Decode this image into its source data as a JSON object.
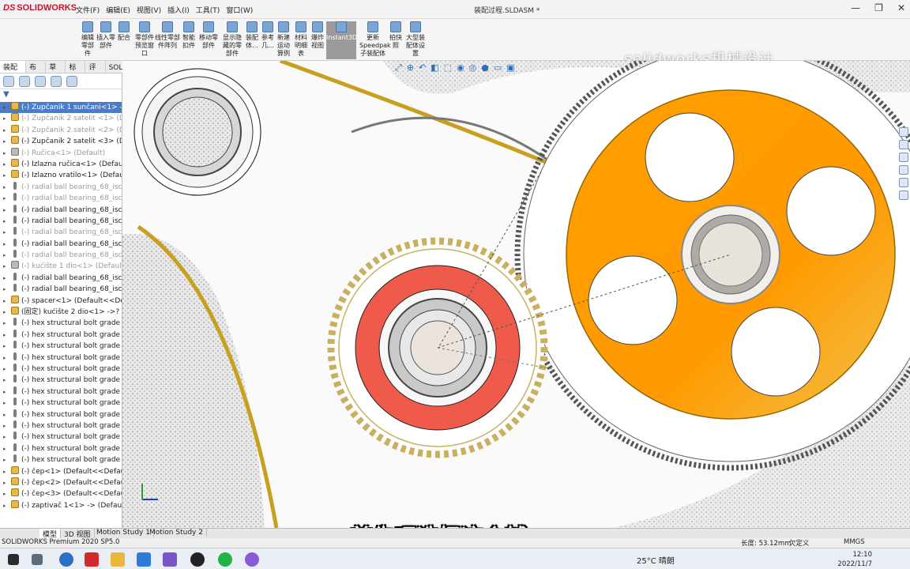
{
  "app": {
    "logo_text": "SOLIDWORKS",
    "document_title": "装配过程.SLDASM *",
    "menus": [
      "文件(F)",
      "编辑(E)",
      "视图(V)",
      "插入(I)",
      "工具(T)",
      "窗口(W)"
    ]
  },
  "ribbon": {
    "buttons": [
      "编辑零部件",
      "插入零部件",
      "配合",
      "零部件预览窗口",
      "线性零部件阵列",
      "智能扣件",
      "移动零部件",
      "显示隐藏的零部件",
      "装配体...",
      "参考几...",
      "新建运动算例",
      "材料明细表",
      "爆炸视图",
      "Instant3D",
      "更新Speedpak子装配体",
      "拍快照",
      "大型装配体设置"
    ],
    "active_button": "Instant3D"
  },
  "watermark": "solidworks机械设计",
  "command_tabs": [
    "装配体",
    "布局",
    "草图",
    "标注",
    "评估",
    "SOLIDWORKS 插件"
  ],
  "feature_tree": {
    "items": [
      {
        "label": "(-) Zupčanik 1 sunčani<1> -",
        "type": "asm",
        "state": "selected"
      },
      {
        "label": "(-) Zupčanik 2 satelit <1> (D",
        "type": "asm",
        "state": "suppressed"
      },
      {
        "label": "(-) Zupčanik 2 satelit <2> (D",
        "type": "asm",
        "state": "suppressed"
      },
      {
        "label": "(-) Zupčanik 2 satelit <3> (D",
        "type": "asm",
        "state": "normal"
      },
      {
        "label": "(-) Ručica<1> (Default)",
        "type": "part",
        "state": "suppressed"
      },
      {
        "label": "(-) Izlazna ručica<1> (Defau",
        "type": "asm",
        "state": "normal"
      },
      {
        "label": "(-) Izlazno vratilo<1> (Defau",
        "type": "asm",
        "state": "normal"
      },
      {
        "label": "(-) radial ball bearing_68_isc",
        "type": "bolt",
        "state": "suppressed"
      },
      {
        "label": "(-) radial ball bearing_68_isc",
        "type": "bolt",
        "state": "suppressed"
      },
      {
        "label": "(-) radial ball bearing_68_isc",
        "type": "bolt",
        "state": "normal"
      },
      {
        "label": "(-) radial ball bearing_68_isc",
        "type": "bolt",
        "state": "normal"
      },
      {
        "label": "(-) radial ball bearing_68_isc",
        "type": "bolt",
        "state": "suppressed"
      },
      {
        "label": "(-) radial ball bearing_68_isc",
        "type": "bolt",
        "state": "normal"
      },
      {
        "label": "(-) radial ball bearing_68_isc",
        "type": "bolt",
        "state": "suppressed"
      },
      {
        "label": "(-) kućište 1 dio<1> (Default",
        "type": "part",
        "state": "suppressed"
      },
      {
        "label": "(-) radial ball bearing_68_isc",
        "type": "bolt",
        "state": "normal"
      },
      {
        "label": "(-) radial ball bearing_68_isc",
        "type": "bolt",
        "state": "normal"
      },
      {
        "label": "(-) spacer<1> (Default<<De",
        "type": "asm",
        "state": "normal"
      },
      {
        "label": "(固定) kućište 2 dio<1> ->? (",
        "type": "asm",
        "state": "normal"
      },
      {
        "label": "(-) hex structural bolt grade",
        "type": "bolt",
        "state": "normal"
      },
      {
        "label": "(-) hex structural bolt grade",
        "type": "bolt",
        "state": "normal"
      },
      {
        "label": "(-) hex structural bolt grade",
        "type": "bolt",
        "state": "normal"
      },
      {
        "label": "(-) hex structural bolt grade",
        "type": "bolt",
        "state": "normal"
      },
      {
        "label": "(-) hex structural bolt grade",
        "type": "bolt",
        "state": "normal"
      },
      {
        "label": "(-) hex structural bolt grade",
        "type": "bolt",
        "state": "normal"
      },
      {
        "label": "(-) hex structural bolt grade",
        "type": "bolt",
        "state": "normal"
      },
      {
        "label": "(-) hex structural bolt grade",
        "type": "bolt",
        "state": "normal"
      },
      {
        "label": "(-) hex structural bolt grade",
        "type": "bolt",
        "state": "normal"
      },
      {
        "label": "(-) hex structural bolt grade",
        "type": "bolt",
        "state": "normal"
      },
      {
        "label": "(-) hex structural bolt grade",
        "type": "bolt",
        "state": "normal"
      },
      {
        "label": "(-) hex structural bolt grade",
        "type": "bolt",
        "state": "normal"
      },
      {
        "label": "(-) hex structural bolt grade",
        "type": "bolt",
        "state": "normal"
      },
      {
        "label": "(-) čep<1> (Default<<Defau",
        "type": "asm",
        "state": "normal"
      },
      {
        "label": "(-) čep<2> (Default<<Defau",
        "type": "asm",
        "state": "normal"
      },
      {
        "label": "(-) čep<3> (Default<<Defau",
        "type": "asm",
        "state": "normal"
      },
      {
        "label": "(-) zaptivač 1<1> -> (Defau",
        "type": "asm",
        "state": "normal"
      }
    ]
  },
  "bottom_tabs": [
    "模型",
    "3D 视图",
    "Motion Study 1",
    "Motion Study 2"
  ],
  "status": {
    "product": "SOLIDWORKS Premium 2020 SP5.0",
    "measure": "长度: 53.12mm",
    "definition": "欠定义",
    "units": "MMGS"
  },
  "subtitle": "首先呢选择这个辅",
  "taskbar": {
    "temperature": "25°C",
    "weather": "晴朗",
    "time": "12:10",
    "date": "2022/11/7"
  },
  "colors": {
    "sun_gear": "#ff9900",
    "highlight_ring": "#f05a4a",
    "gear_outline": "#c8b060",
    "selection": "#4b7cc7"
  }
}
